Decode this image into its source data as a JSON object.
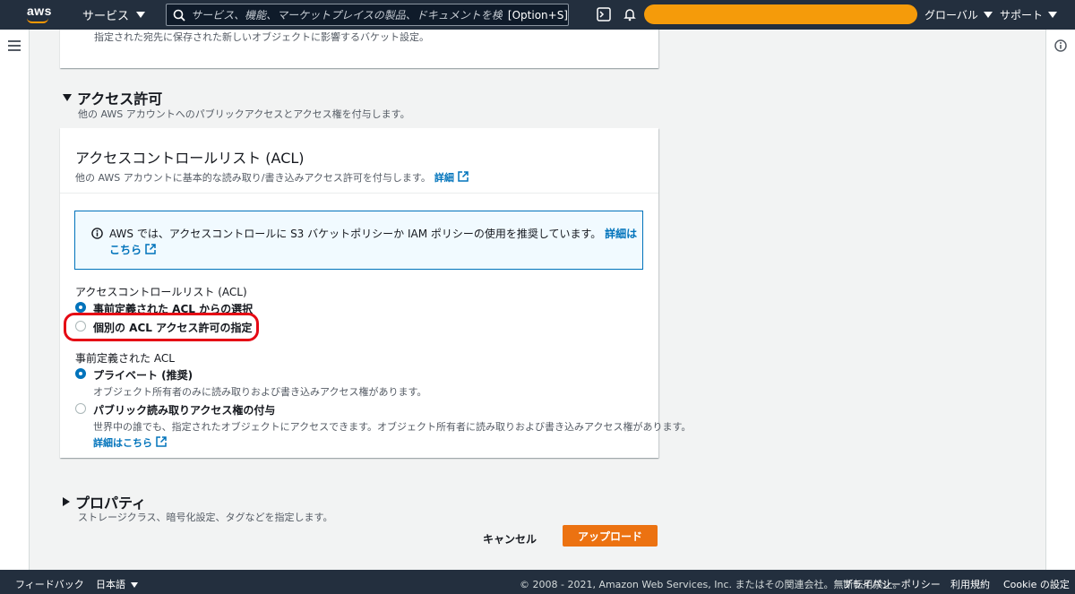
{
  "topnav": {
    "logo_text": "aws",
    "services_label": "サービス",
    "search_placeholder": "サービス、機能、マーケットプレイスの製品、ドキュメントを検索",
    "search_shortcut": "[Option+S]",
    "region_label": "グローバル",
    "support_label": "サポート",
    "accent_color": "#ff9900"
  },
  "top_section": {
    "description": "指定された宛先に保存された新しいオブジェクトに影響するバケット設定。"
  },
  "permissions": {
    "title": "アクセス許可",
    "description": "他の AWS アカウントへのパブリックアクセスとアクセス権を付与します。",
    "acl_card": {
      "title": "アクセスコントロールリスト (ACL)",
      "description": "他の AWS アカウントに基本的な読み取り/書き込みアクセス許可を付与します。",
      "details_link": "詳細",
      "info_text": "AWS では、アクセスコントロールに S3 バケットポリシーか IAM ポリシーの使用を推奨しています。",
      "info_link": "詳細はこちら",
      "acl_field_label": "アクセスコントロールリスト (ACL)",
      "acl_options": [
        {
          "label": "事前定義された ACL からの選択",
          "checked": true
        },
        {
          "label": "個別の ACL アクセス許可の指定",
          "checked": false
        }
      ],
      "predefined_label": "事前定義された ACL",
      "predefined_options": [
        {
          "label": "プライベート (推奨)",
          "sub": "オブジェクト所有者のみに読み取りおよび書き込みアクセス権があります。",
          "checked": true
        },
        {
          "label": "パブリック読み取りアクセス権の付与",
          "sub": "世界中の誰でも、指定されたオブジェクトにアクセスできます。オブジェクト所有者に読み取りおよび書き込みアクセス権があります。",
          "link": "詳細はこちら",
          "checked": false
        }
      ]
    }
  },
  "properties": {
    "title": "プロパティ",
    "description": "ストレージクラス、暗号化設定、タグなどを指定します。"
  },
  "actions": {
    "cancel_label": "キャンセル",
    "upload_label": "アップロード"
  },
  "footer": {
    "feedback": "フィードバック",
    "language": "日本語",
    "copyright": "© 2008 - 2021, Amazon Web Services, Inc. またはその関連会社。無断転用禁止。",
    "privacy": "プライバシーポリシー",
    "terms": "利用規約",
    "cookie": "Cookie の設定"
  }
}
